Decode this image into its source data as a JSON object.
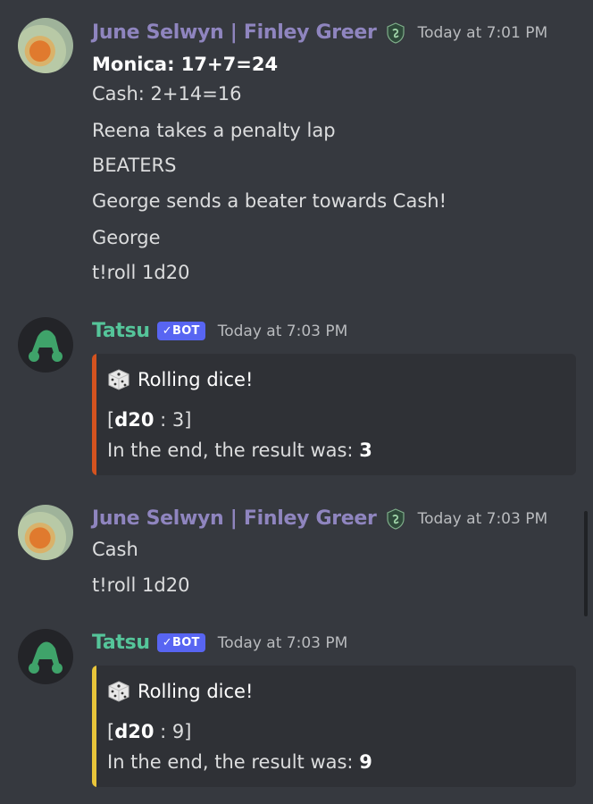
{
  "messages": [
    {
      "author": "June Selwyn | Finley Greer",
      "icon": "shield-icon",
      "timestamp": "Today at 7:01 PM",
      "lines": [
        {
          "text": "Monica: 17+7=24",
          "bold": true
        },
        {
          "text": "Cash: 2+14=16"
        },
        {
          "text": "Reena takes a penalty lap"
        },
        {
          "text": "BEATERS"
        },
        {
          "text": "George sends a beater towards Cash!"
        },
        {
          "text": "George"
        },
        {
          "text": "t!roll 1d20"
        }
      ]
    },
    {
      "author": "Tatsu",
      "badge": "✓BOT",
      "timestamp": "Today at 7:03 PM",
      "embed": {
        "accent": "#d4531f",
        "title": "Rolling dice!",
        "roll_open": "[",
        "die": "d20",
        "roll_rest": " : 3]",
        "result_prefix": "In the end, the result was: ",
        "result": "3"
      }
    },
    {
      "author": "June Selwyn | Finley Greer",
      "icon": "shield-icon",
      "timestamp": "Today at 7:03 PM",
      "lines": [
        {
          "text": "Cash"
        },
        {
          "text": "t!roll 1d20"
        }
      ]
    },
    {
      "author": "Tatsu",
      "badge": "✓BOT",
      "timestamp": "Today at 7:03 PM",
      "embed": {
        "accent": "#e9c53a",
        "title": "Rolling dice!",
        "roll_open": "[",
        "die": "d20",
        "roll_rest": " : 9]",
        "result_prefix": "In the end, the result was: ",
        "result": "9"
      }
    }
  ],
  "colors": {
    "background": "#36393f",
    "embed_background": "#2f3136",
    "june_name": "#8f85bf",
    "tatsu_name": "#55c59a",
    "bot_badge": "#5865f2"
  }
}
